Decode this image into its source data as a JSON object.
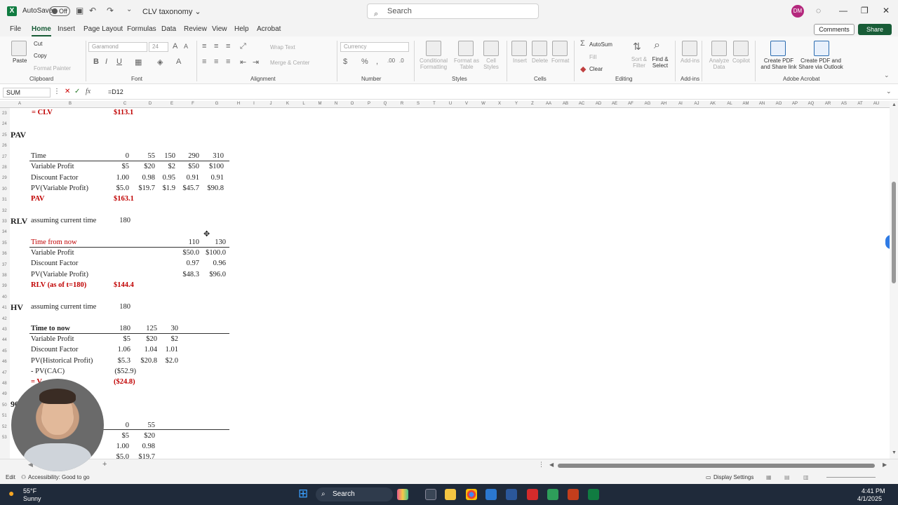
{
  "titlebar": {
    "autosave_label": "AutoSave",
    "autosave_state": "Off",
    "doc_name": "CLV taxonomy ⌄",
    "search_placeholder": "Search",
    "user_initials": "DM"
  },
  "menu": {
    "file": "File",
    "home": "Home",
    "insert": "Insert",
    "page_layout": "Page Layout",
    "formulas": "Formulas",
    "data": "Data",
    "review": "Review",
    "view": "View",
    "help": "Help",
    "acrobat": "Acrobat",
    "comments": "Comments",
    "share": "Share"
  },
  "ribbon": {
    "paste": "Paste",
    "cut": "Cut",
    "copy": "Copy",
    "format_painter": "Format Painter",
    "clipboard": "Clipboard",
    "font_name": "Garamond",
    "font_size": "24",
    "font": "Font",
    "wrap_text": "Wrap Text",
    "merge_center": "Merge & Center",
    "alignment": "Alignment",
    "number_format": "Currency",
    "number": "Number",
    "conditional_formatting": "Conditional Formatting",
    "format_as_table": "Format as Table",
    "cell_styles": "Cell Styles",
    "styles": "Styles",
    "insert": "Insert",
    "delete": "Delete",
    "format": "Format",
    "cells": "Cells",
    "autosum": "AutoSum",
    "fill": "Fill",
    "clear": "Clear",
    "sort_filter": "Sort & Filter",
    "find_select": "Find & Select",
    "editing": "Editing",
    "add_ins": "Add-ins",
    "add_ins_group": "Add-ins",
    "analyze_data": "Analyze Data",
    "copilot": "Copilot",
    "create_pdf_link": "Create PDF and Share link",
    "create_pdf_outlook": "Create PDF and Share via Outlook",
    "adobe_acrobat": "Adobe Acrobat"
  },
  "formula_bar": {
    "name_box": "SUM",
    "formula": "=D12"
  },
  "columns": [
    "A",
    "B",
    "C",
    "D",
    "E",
    "F",
    "G",
    "H",
    "I",
    "J",
    "K",
    "L",
    "M",
    "N",
    "O",
    "P",
    "Q",
    "R",
    "S",
    "T",
    "U",
    "V",
    "W",
    "X",
    "Y",
    "Z",
    "AA",
    "AB",
    "AC",
    "AD",
    "AE",
    "AF",
    "AG",
    "AH",
    "AI",
    "AJ",
    "AK",
    "AL",
    "AM",
    "AN",
    "AO",
    "AP",
    "AQ",
    "AR",
    "AS",
    "AT",
    "AU"
  ],
  "rows": [
    "23",
    "24",
    "25",
    "26",
    "27",
    "28",
    "29",
    "30",
    "31",
    "32",
    "33",
    "34",
    "35",
    "36",
    "37",
    "38",
    "39",
    "40",
    "41",
    "42",
    "43",
    "44",
    "45",
    "46",
    "47",
    "48",
    "49",
    "50",
    "51",
    "52",
    "53"
  ],
  "sheet": {
    "clv_label": "= CLV",
    "clv_value": "$113.1",
    "pav_title": "PAV",
    "pav_time_label": "Time",
    "pav_times": [
      "0",
      "55",
      "150",
      "290",
      "310"
    ],
    "pav_vp_label": "Variable Profit",
    "pav_vp": [
      "$5",
      "$20",
      "$2",
      "$50",
      "$100"
    ],
    "pav_df_label": "Discount Factor",
    "pav_df": [
      "1.00",
      "0.98",
      "0.95",
      "0.91",
      "0.91"
    ],
    "pav_pv_label": "PV(Variable Profit)",
    "pav_pv": [
      "$5.0",
      "$19.7",
      "$1.9",
      "$45.7",
      "$90.8"
    ],
    "pav_label": "PAV",
    "pav_value": "$163.1",
    "rlv_title": "RLV",
    "rlv_assume": "assuming current time",
    "rlv_time": "180",
    "rlv_tfn_label": "Time from now",
    "rlv_tfn": [
      "110",
      "130"
    ],
    "rlv_vp_label": "Variable Profit",
    "rlv_vp": [
      "$50.0",
      "$100.0"
    ],
    "rlv_df_label": "Discount Factor",
    "rlv_df": [
      "0.97",
      "0.96"
    ],
    "rlv_pv_label": "PV(Variable Profit)",
    "rlv_pv": [
      "$48.3",
      "$96.0"
    ],
    "rlv_label": "RLV (as of t=180)",
    "rlv_value": "$144.4",
    "hv_title": "HV",
    "hv_assume": "assuming current time",
    "hv_time": "180",
    "hv_ttn_label": "Time to now",
    "hv_ttn": [
      "180",
      "125",
      "30"
    ],
    "hv_vp_label": "Variable Profit",
    "hv_vp": [
      "$5",
      "$20",
      "$2"
    ],
    "hv_df_label": "Discount Factor",
    "hv_df": [
      "1.06",
      "1.04",
      "1.01"
    ],
    "hv_pv_label": "PV(Historical Profit)",
    "hv_pv": [
      "$5.3",
      "$20.8",
      "$2.0"
    ],
    "hv_cac_label": "- PV(CAC)",
    "hv_cac": "($52.9)",
    "hv_result_label": "= V",
    "hv_result": "($24.8)",
    "next_prefix": "90",
    "next_times": [
      "0",
      "55"
    ],
    "next_vp": [
      "$5",
      "$20"
    ],
    "next_df": [
      "1.00",
      "0.98"
    ],
    "next_pv": [
      "$5.0",
      "$19.7"
    ]
  },
  "status": {
    "mode": "Edit",
    "accessibility": "Accessibility: Good to go",
    "display_settings": "Display Settings"
  },
  "taskbar": {
    "temp": "55°F",
    "weather": "Sunny",
    "search": "Search",
    "time": "4:41 PM",
    "date": "4/1/2025"
  }
}
